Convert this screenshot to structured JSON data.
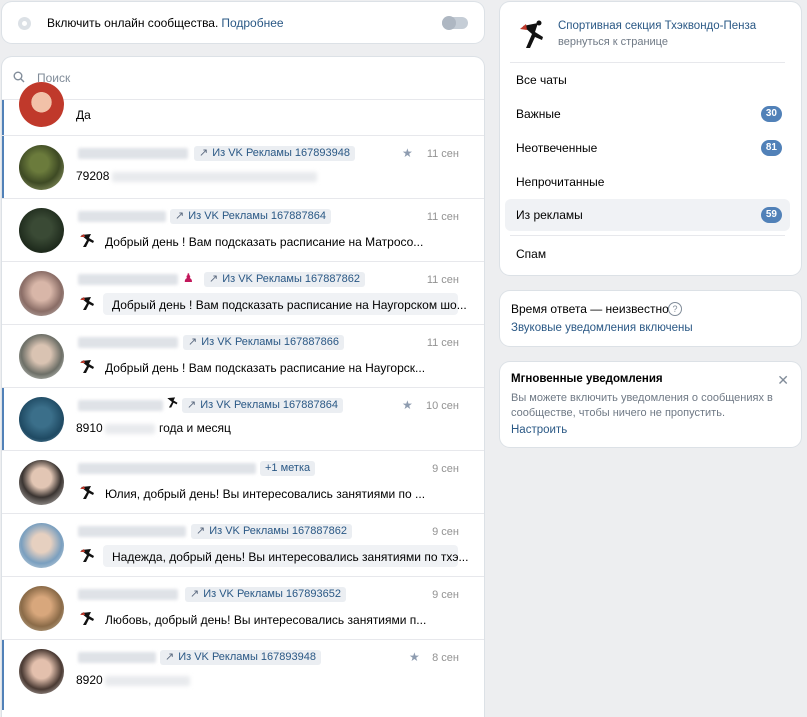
{
  "toggle": {
    "label": "Включить онлайн сообщества.",
    "more": "Подробнее"
  },
  "search": {
    "placeholder": "Поиск"
  },
  "chats": [
    {
      "message": "Да"
    },
    {
      "tag": "Из VK Рекламы 167893948",
      "date": "11 сен",
      "starred": true,
      "message": "79208"
    },
    {
      "tag": "Из VK Рекламы 167887864",
      "date": "11 сен",
      "message": "Добрый день ! Вам подсказать расписание на Матросо..."
    },
    {
      "tag": "Из VK Рекламы 167887862",
      "date": "11 сен",
      "message": "Добрый день ! Вам подсказать расписание на Наугорском шо..."
    },
    {
      "tag": "Из VK Рекламы 167887866",
      "date": "11 сен",
      "message": "Добрый день ! Вам подсказать расписание на Наугорск..."
    },
    {
      "tag": "Из VK Рекламы 167887864",
      "date": "10 сен",
      "starred": true,
      "message_prefix": "8910",
      "message_suffix": "года и месяц"
    },
    {
      "tag": "+1 метка",
      "date": "9 сен",
      "message": "Юлия, добрый день! Вы интересовались занятиями по ..."
    },
    {
      "tag": "Из VK Рекламы 167887862",
      "date": "9 сен",
      "message": "Надежда, добрый день! Вы интересовались занятиями по тхэ..."
    },
    {
      "tag": "Из VK Рекламы 167893652",
      "date": "9 сен",
      "message": "Любовь, добрый день! Вы интересовались занятиями п..."
    },
    {
      "tag": "Из VK Рекламы 167893948",
      "date": "8 сен",
      "starred": true,
      "message": "8920"
    }
  ],
  "community": {
    "name": "Спортивная секция Тхэквондо-Пенза",
    "back": "вернуться к странице"
  },
  "menu": [
    {
      "label": "Все чаты"
    },
    {
      "label": "Важные",
      "count": "30"
    },
    {
      "label": "Неотвеченные",
      "count": "81"
    },
    {
      "label": "Непрочитанные"
    },
    {
      "label": "Из рекламы",
      "count": "59",
      "active": true
    },
    {
      "label": "Спам"
    }
  ],
  "response": {
    "title": "Время ответа — неизвестно",
    "help": "?",
    "sounds": "Звуковые уведомления включены"
  },
  "notifications": {
    "title": "Мгновенные уведомления",
    "text": "Вы можете включить уведомления о сообщениях в сообществе, чтобы ничего не пропустить.",
    "link": "Настроить",
    "close": "✕"
  },
  "colors": {
    "accent": "#5181b8",
    "link": "#2a5885",
    "background": "#edeef0"
  }
}
